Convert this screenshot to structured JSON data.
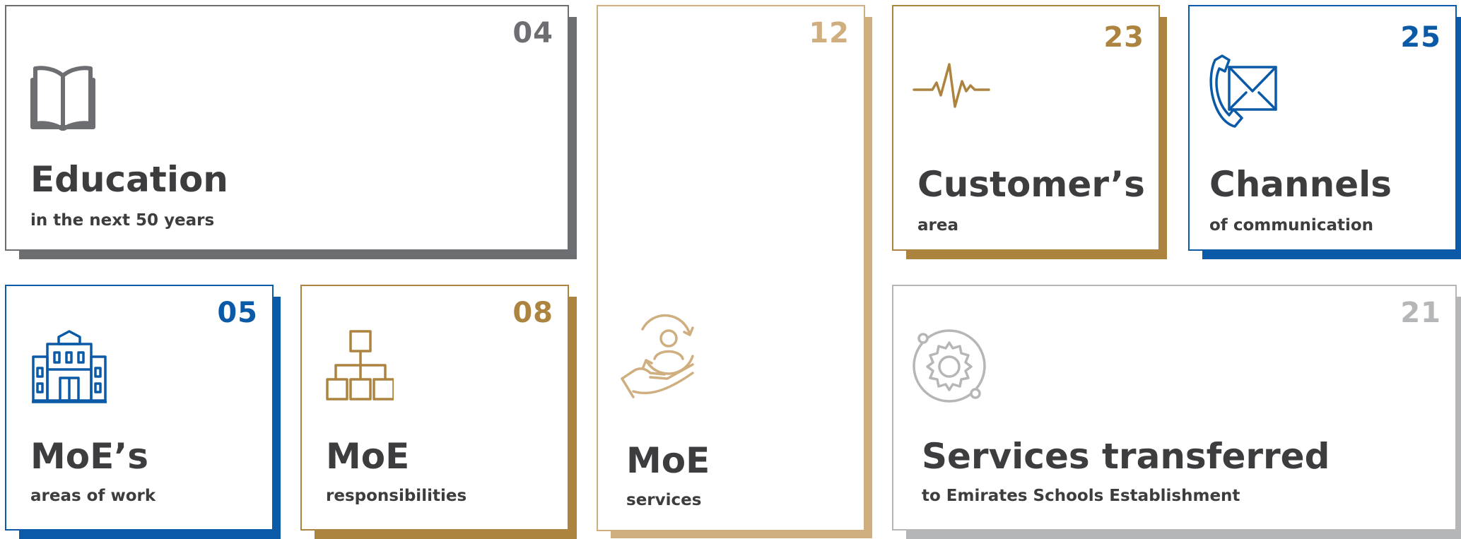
{
  "colors": {
    "gray": "#6d6e71",
    "blue": "#0b5aa7",
    "gold": "#ad843f",
    "sand": "#cfae7f",
    "lightgray": "#b5b6b8",
    "text": "#3d3d3f"
  },
  "cards": {
    "education": {
      "number": "04",
      "title": "Education",
      "subtitle": "in the next 50 years",
      "icon": "open-book-icon"
    },
    "services": {
      "number": "12",
      "title": "MoE",
      "subtitle": "services",
      "icon": "hand-user-cycle-icon"
    },
    "customers": {
      "number": "23",
      "title": "Customer’s",
      "subtitle": "area",
      "icon": "heartbeat-pulse-icon"
    },
    "channels": {
      "number": "25",
      "title": "Channels",
      "subtitle": "of communication",
      "icon": "phone-envelope-icon"
    },
    "areas": {
      "number": "05",
      "title": "MoE’s",
      "subtitle": "areas of work",
      "icon": "school-building-icon"
    },
    "responsibilities": {
      "number": "08",
      "title": "MoE",
      "subtitle": "responsibilities",
      "icon": "org-chart-icon"
    },
    "transferred": {
      "number": "21",
      "title": "Services transferred",
      "subtitle": "to Emirates Schools Establishment",
      "icon": "gear-cycle-icon"
    }
  }
}
